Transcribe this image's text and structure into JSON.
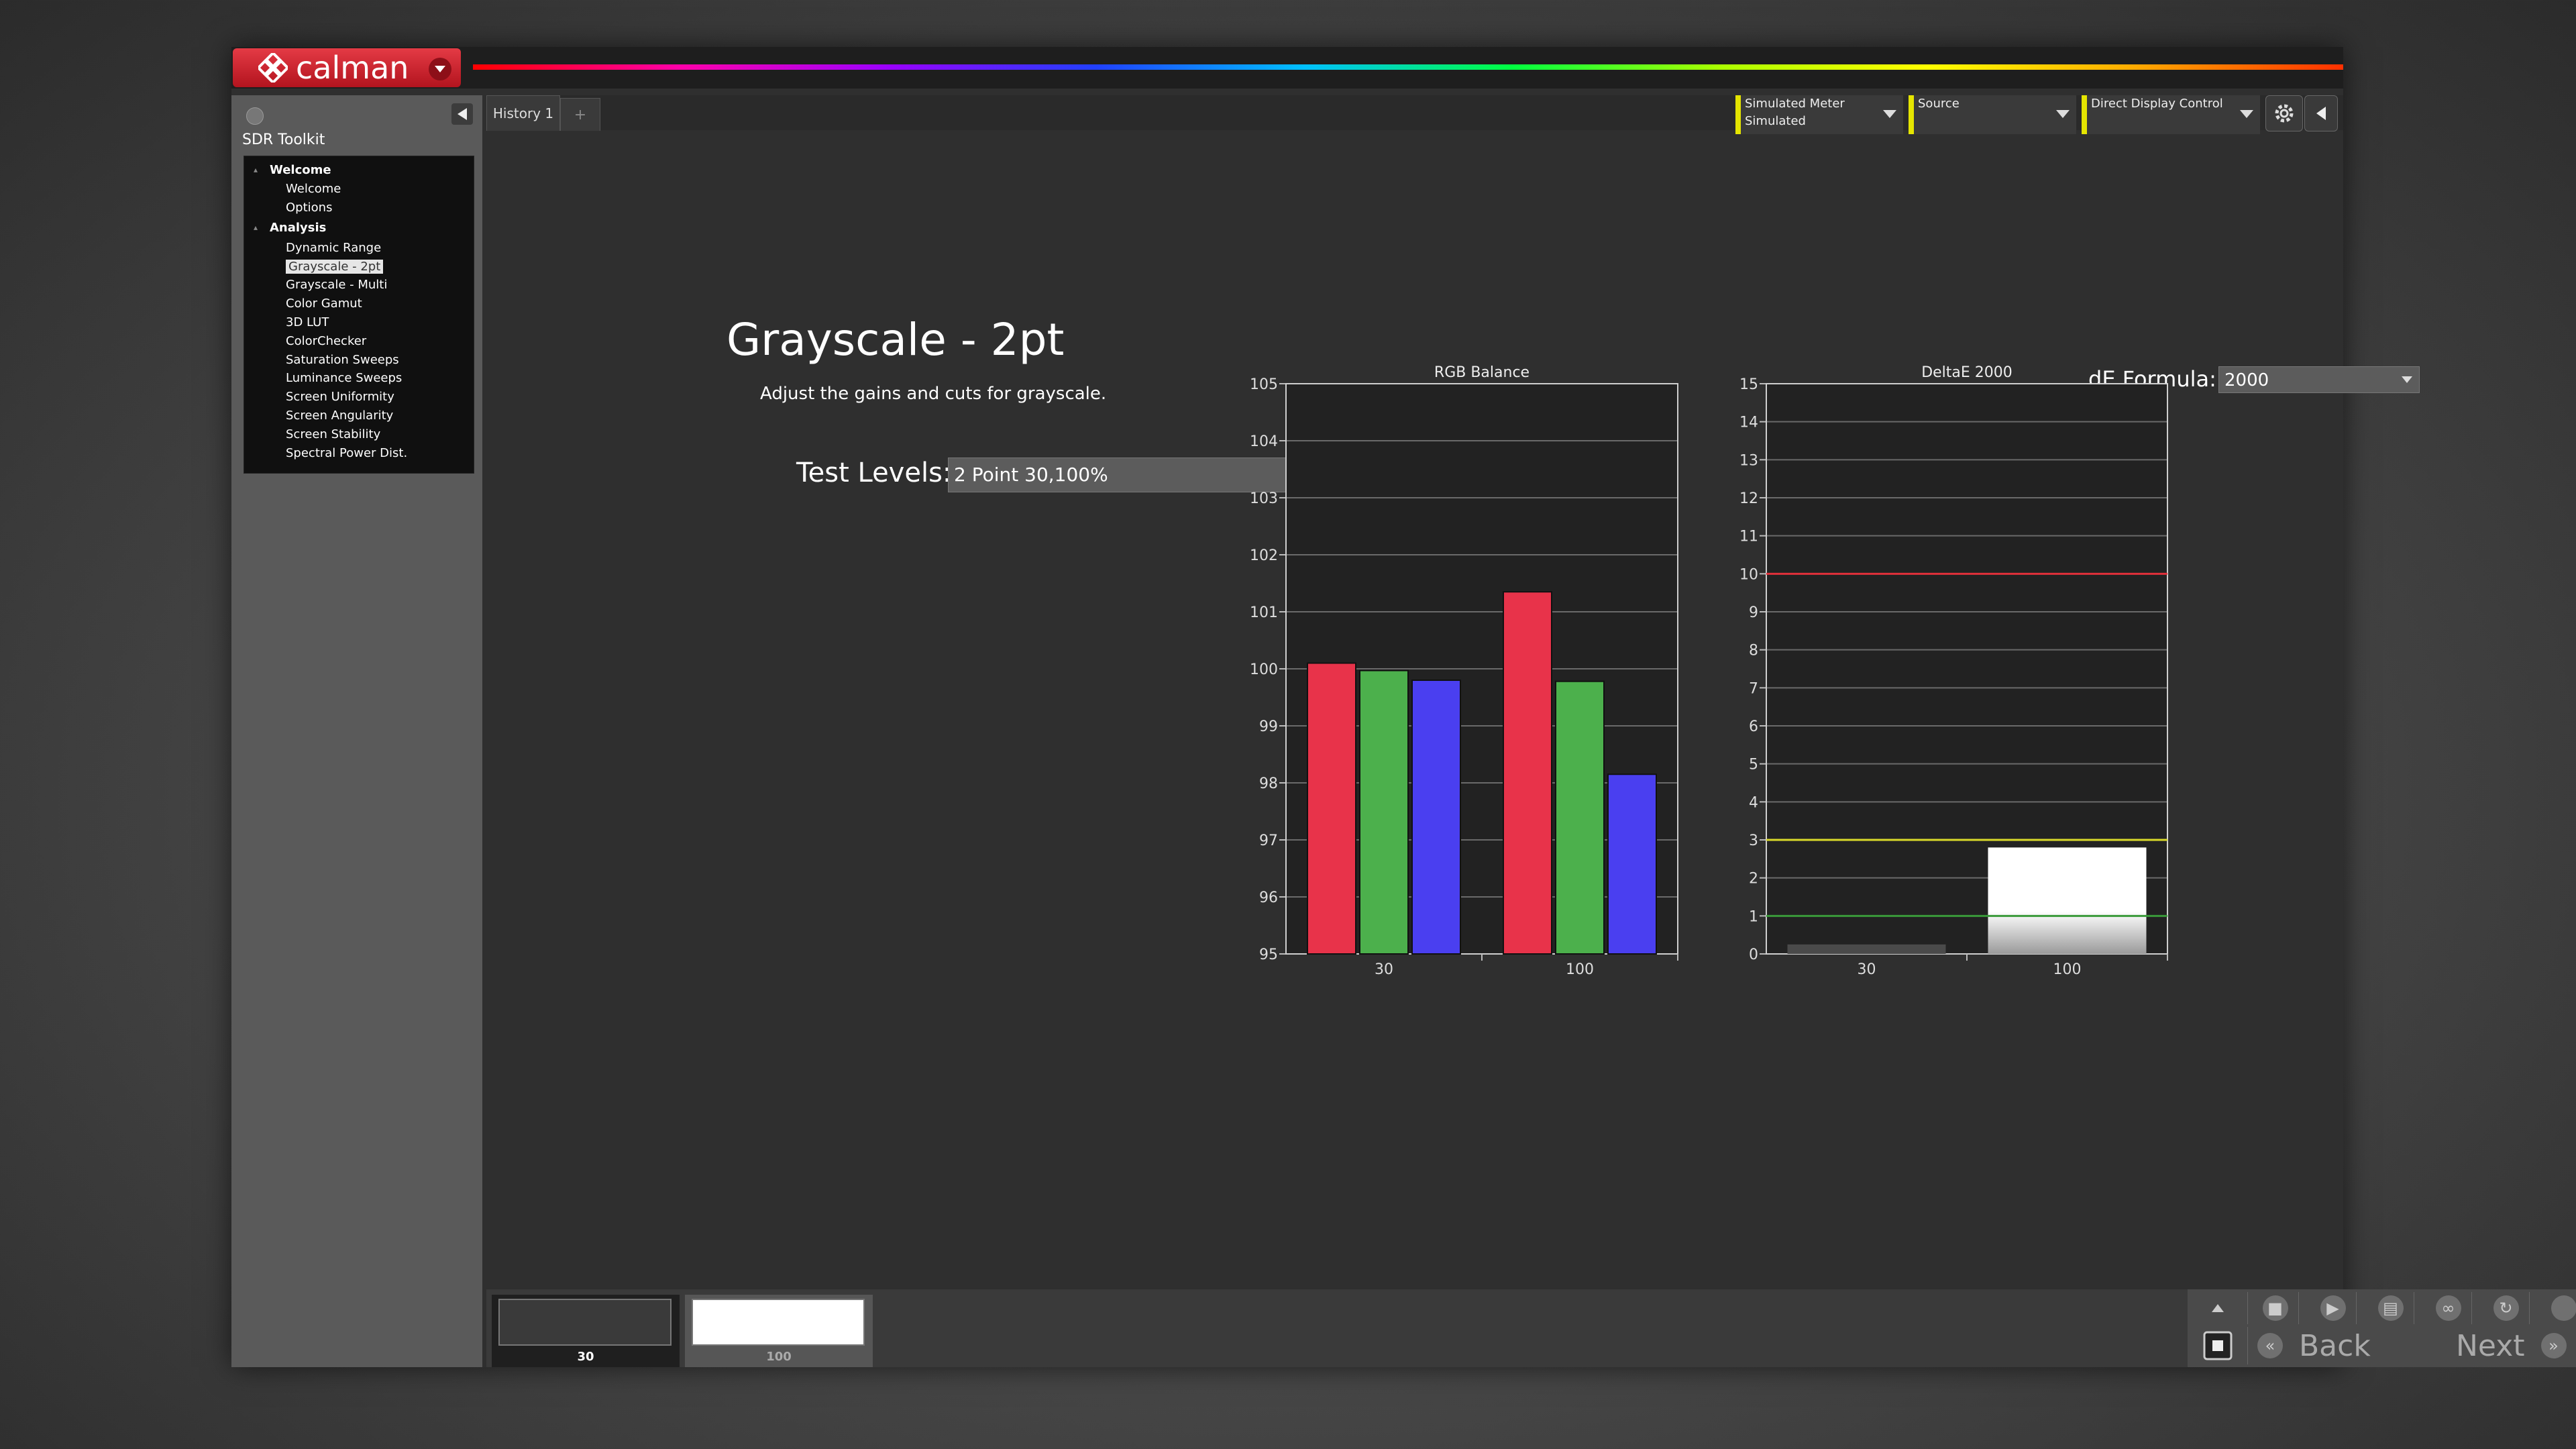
{
  "app": {
    "logo_text": "calman"
  },
  "sidebar": {
    "title": "SDR Toolkit",
    "items": [
      {
        "label": "Welcome",
        "group": true
      },
      {
        "label": "Welcome"
      },
      {
        "label": "Options"
      },
      {
        "label": "Analysis",
        "group": true
      },
      {
        "label": "Dynamic Range"
      },
      {
        "label": "Grayscale - 2pt",
        "selected": true
      },
      {
        "label": "Grayscale - Multi"
      },
      {
        "label": "Color Gamut"
      },
      {
        "label": "3D LUT"
      },
      {
        "label": "ColorChecker"
      },
      {
        "label": "Saturation Sweeps"
      },
      {
        "label": "Luminance Sweeps"
      },
      {
        "label": "Screen Uniformity"
      },
      {
        "label": "Screen Angularity"
      },
      {
        "label": "Screen Stability"
      },
      {
        "label": "Spectral Power Dist."
      }
    ]
  },
  "tabs": {
    "history": "History 1",
    "add": "+"
  },
  "devices": {
    "meter": {
      "line1": "Simulated Meter",
      "line2": "Simulated"
    },
    "source": {
      "line1": "Source"
    },
    "display": {
      "line1": "Direct Display Control"
    }
  },
  "icons": {
    "settings": "gear-icon",
    "collapse": "chevron-left-icon"
  },
  "main": {
    "title": "Grayscale - 2pt",
    "description": "Adjust the gains and cuts for grayscale.",
    "test_levels_label": "Test Levels:",
    "test_levels_value": "2 Point 30,100%",
    "de_formula_label": "dE Formula:",
    "de_formula_value": "2000"
  },
  "chart_data": [
    {
      "type": "bar",
      "title": "RGB Balance",
      "categories": [
        "30",
        "100"
      ],
      "series": [
        {
          "color": "#e8334a",
          "values": [
            100.1,
            101.35
          ]
        },
        {
          "color": "#4cb04c",
          "values": [
            99.97,
            99.78
          ]
        },
        {
          "color": "#4a3ff0",
          "values": [
            99.8,
            98.15
          ]
        }
      ],
      "ylim": [
        95,
        105
      ],
      "yticks": [
        95,
        96,
        97,
        98,
        99,
        100,
        101,
        102,
        103,
        104,
        105
      ],
      "grid": true
    },
    {
      "type": "bar",
      "title": "DeltaE 2000",
      "categories": [
        "30",
        "100"
      ],
      "values": [
        0.25,
        2.8
      ],
      "ylim": [
        0,
        15
      ],
      "yticks": [
        0,
        1,
        2,
        3,
        4,
        5,
        6,
        7,
        8,
        9,
        10,
        11,
        12,
        13,
        14,
        15
      ],
      "thresholds": [
        {
          "value": 10,
          "color": "#e0303a"
        },
        {
          "value": 3,
          "color": "#d9d92a"
        },
        {
          "value": 1,
          "color": "#3a9a3a"
        }
      ],
      "grid": true
    }
  ],
  "bottom": {
    "swatches": [
      {
        "label": "30",
        "color": "#3a3a3a",
        "active": true
      },
      {
        "label": "100",
        "color": "#ffffff",
        "active": false
      }
    ],
    "back": "Back",
    "next": "Next"
  }
}
